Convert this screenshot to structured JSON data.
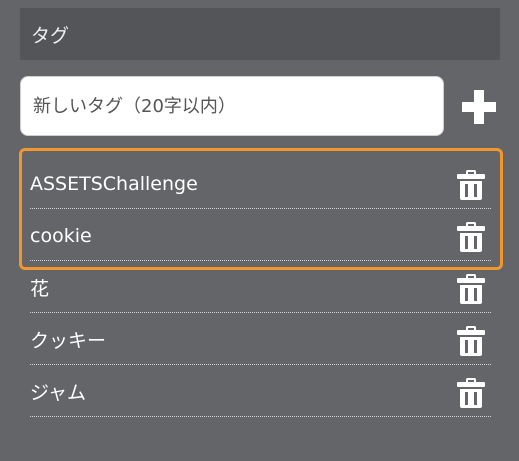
{
  "header": {
    "title": "タグ"
  },
  "tag_input": {
    "placeholder": "新しいタグ（20字以内）"
  },
  "add_button": {
    "icon": "plus-icon"
  },
  "highlight_color": "#f3962e",
  "tags": [
    {
      "label": "ASSETSChallenge"
    },
    {
      "label": "cookie"
    },
    {
      "label": "花"
    },
    {
      "label": "クッキー"
    },
    {
      "label": "ジャム"
    }
  ]
}
